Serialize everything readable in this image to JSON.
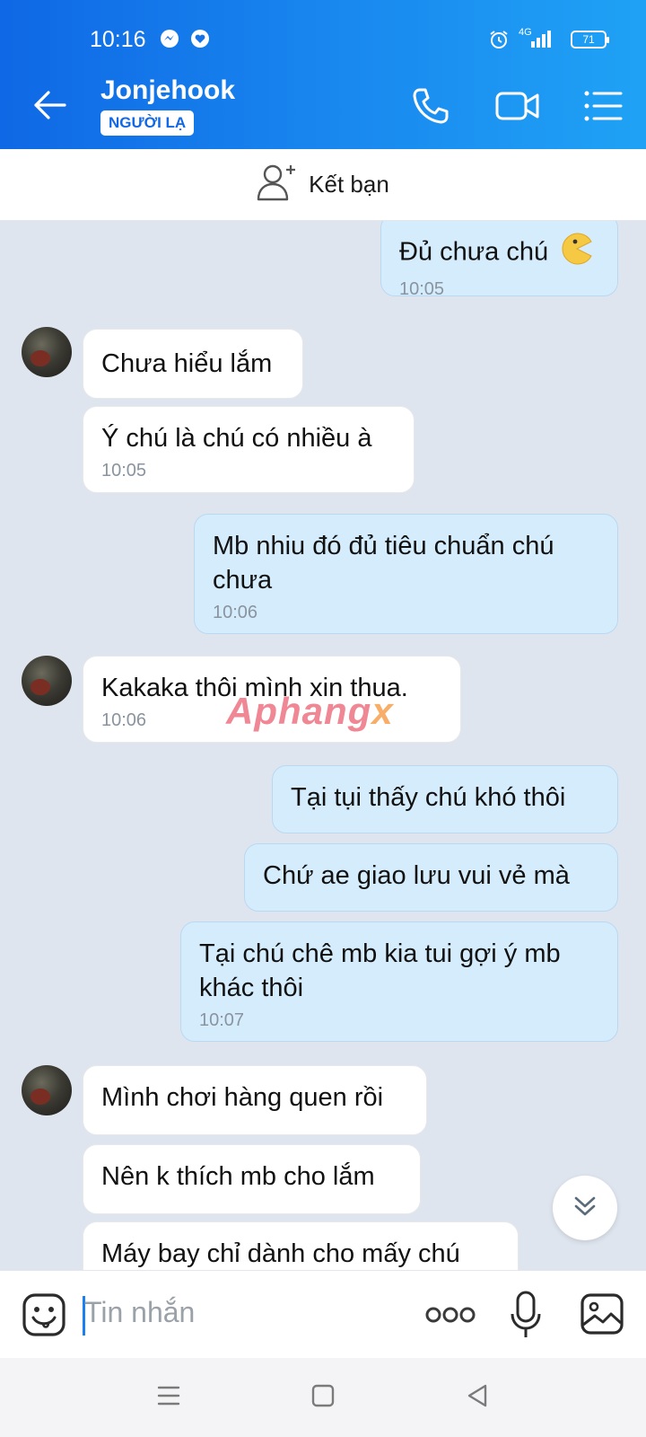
{
  "status_bar": {
    "time": "10:16",
    "network": "4G",
    "battery": "71"
  },
  "header": {
    "contact_name": "Jonjehook",
    "badge": "NGƯỜI LẠ"
  },
  "add_friend": {
    "label": "Kết bạn"
  },
  "messages": [
    {
      "direction": "out",
      "text": "Đủ chưa chú",
      "emoji": "🌝",
      "time": "10:05"
    },
    {
      "direction": "in",
      "text": "Chưa hiểu lắm",
      "time": ""
    },
    {
      "direction": "in",
      "text": "Ý chú là chú có nhiều à",
      "time": "10:05"
    },
    {
      "direction": "out",
      "text": "Mb nhiu đó đủ tiêu chuẩn chú chưa",
      "time": "10:06"
    },
    {
      "direction": "in",
      "text": "Kakaka thôi mình xin thua.",
      "time": "10:06"
    },
    {
      "direction": "out",
      "text": "Tại tụi thấy chú khó thôi",
      "time": ""
    },
    {
      "direction": "out",
      "text": "Chứ ae giao lưu vui vẻ mà",
      "time": ""
    },
    {
      "direction": "out",
      "text": "Tại chú chê mb kia tui gợi ý mb khác thôi",
      "time": "10:07"
    },
    {
      "direction": "in",
      "text": "Mình chơi hàng quen rồi",
      "time": ""
    },
    {
      "direction": "in",
      "text": "Nên k thích mb cho lắm",
      "time": ""
    },
    {
      "direction": "in",
      "text": "Máy bay chỉ dành cho mấy chú",
      "time": ""
    }
  ],
  "watermark": {
    "main": "Aphang",
    "suffix": "x"
  },
  "input": {
    "placeholder": "Tin nhắn"
  },
  "colors": {
    "header_start": "#0f68e5",
    "header_end": "#1fa2f5",
    "outgoing_bubble": "#d5ecfd",
    "incoming_bubble": "#ffffff",
    "chat_background": "#dfe5ee"
  }
}
